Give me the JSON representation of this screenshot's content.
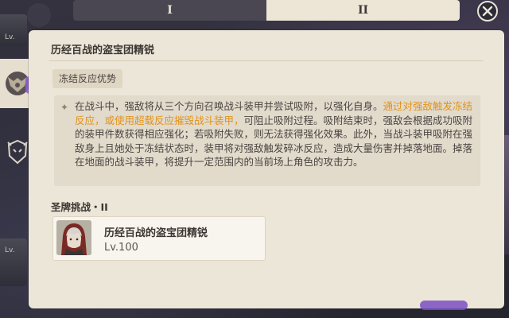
{
  "background": {
    "level_labels": [
      "Lv.",
      "Lv."
    ]
  },
  "tabs": [
    {
      "label": "I",
      "active": false
    },
    {
      "label": "II",
      "active": true
    }
  ],
  "close_icon": "close-icon",
  "side_tabs": [
    {
      "icon": "ruin-guard-emblem-icon",
      "active": true
    },
    {
      "icon": "mask-emblem-icon",
      "active": false
    }
  ],
  "panel": {
    "title": "历经百战的盗宝团精锐",
    "chip": "冻结反应优势",
    "description": {
      "part1": "在战斗中，强敌将从三个方向召唤战斗装甲并尝试吸附，以强化自身。",
      "highlight": "通过对强敌触发冻结反应，或使用超载反应摧毁战斗装甲，",
      "part2": "可阻止吸附过程。吸附结束时，强敌会根据成功吸附的装甲件数获得相应强化；若吸附失败，则无法获得强化效果。此外，当战斗装甲吸附在强敌身上且她处于冻结状态时，装甲将对强敌触发碎冰反应，造成大量伤害并掉落地面。掉落在地面的战斗装甲，将提升一定范围内的当前场上角色的攻击力。"
    },
    "section_title": "圣牌挑战・II",
    "enemy": {
      "name": "历经百战的盗宝团精锐",
      "level": "Lv.100",
      "portrait_icon": "hooded-enemy-portrait"
    }
  },
  "colors": {
    "highlight": "#e0931a",
    "panel_bg": "#ece6d8",
    "accent_purple": "#8a5ed1"
  }
}
